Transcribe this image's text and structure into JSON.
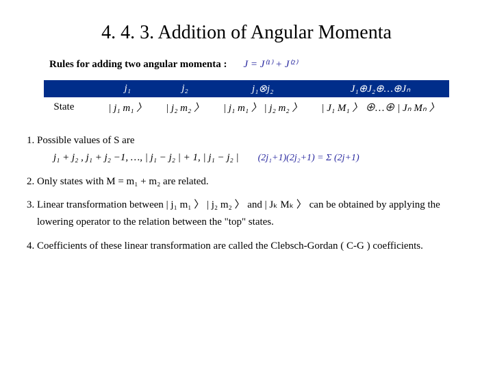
{
  "title": "4. 4. 3.  Addition of Angular Momenta",
  "rules_label": "Rules for adding two angular momenta :",
  "rules_formula": "J = J⁽¹⁾ + J⁽²⁾",
  "table": {
    "head": {
      "blank": " ",
      "c1": "j₁",
      "c2": "j₂",
      "c3": "j₁⊗j₂",
      "c4": "J₁⊕J₂⊕…⊕Jₙ"
    },
    "row": {
      "label": "State",
      "c1": "| j₁ m₁ 〉",
      "c2": "| j₂ m₂ 〉",
      "c3": "| j₁ m₁ 〉 | j₂ m₂ 〉",
      "c4": "| J₁ M₁ 〉 ⊕…⊕ | Jₙ Mₙ 〉"
    }
  },
  "points": {
    "p1a": "Possible values of S are",
    "p1b": "j₁ + j₂ ,  j₁ + j₂ −1,   …, | j₁ − j₂ | + 1,   | j₁ − j₂ |",
    "p1c_sum": "(2j₁+1)(2j₂+1) = Σ (2j+1)",
    "p2": "Only states with  M = m₁ + m₂   are related.",
    "p3": "Linear transformation between | j₁ m₁ 〉 | j₂ m₂ 〉 and | Jₖ Mₖ 〉 can be obtained by applying the lowering operator to the relation between the \"top\" states.",
    "p4": "Coefficients of these linear transformation are called the Clebsch-Gordan ( C-G ) coefficients."
  }
}
